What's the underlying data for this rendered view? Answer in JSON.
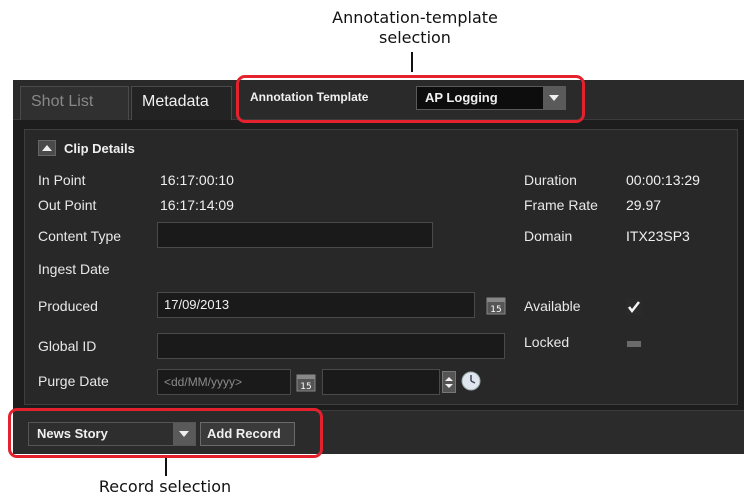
{
  "callouts": {
    "top": {
      "line1": "Annotation-template",
      "line2": "selection"
    },
    "bottom": {
      "text": "Record selection"
    }
  },
  "tabs": [
    {
      "label": "Shot List",
      "active": false
    },
    {
      "label": "Metadata",
      "active": true
    }
  ],
  "annotation_template": {
    "label": "Annotation Template",
    "value": "AP Logging"
  },
  "section": {
    "title": "Clip Details"
  },
  "fields": {
    "in_point": {
      "label": "In Point",
      "value": "16:17:00:10"
    },
    "out_point": {
      "label": "Out Point",
      "value": "16:17:14:09"
    },
    "content_type": {
      "label": "Content Type",
      "value": ""
    },
    "ingest_date": {
      "label": "Ingest Date"
    },
    "produced": {
      "label": "Produced",
      "value": "17/09/2013"
    },
    "global_id": {
      "label": "Global ID",
      "value": ""
    },
    "purge_date": {
      "label": "Purge Date",
      "placeholder": "<dd/MM/yyyy>",
      "time_value": ""
    },
    "duration": {
      "label": "Duration",
      "value": "00:00:13:29"
    },
    "frame_rate": {
      "label": "Frame Rate",
      "value": "29.97"
    },
    "domain": {
      "label": "Domain",
      "value": "ITX23SP3"
    },
    "available": {
      "label": "Available",
      "checked": true
    },
    "locked": {
      "label": "Locked",
      "checked": false
    }
  },
  "calendar_icon_text": "15",
  "footer": {
    "record_type": "News Story",
    "add_record_label": "Add Record"
  },
  "colors": {
    "highlight": "#e3222e",
    "panel_bg": "#1d1d1d"
  }
}
